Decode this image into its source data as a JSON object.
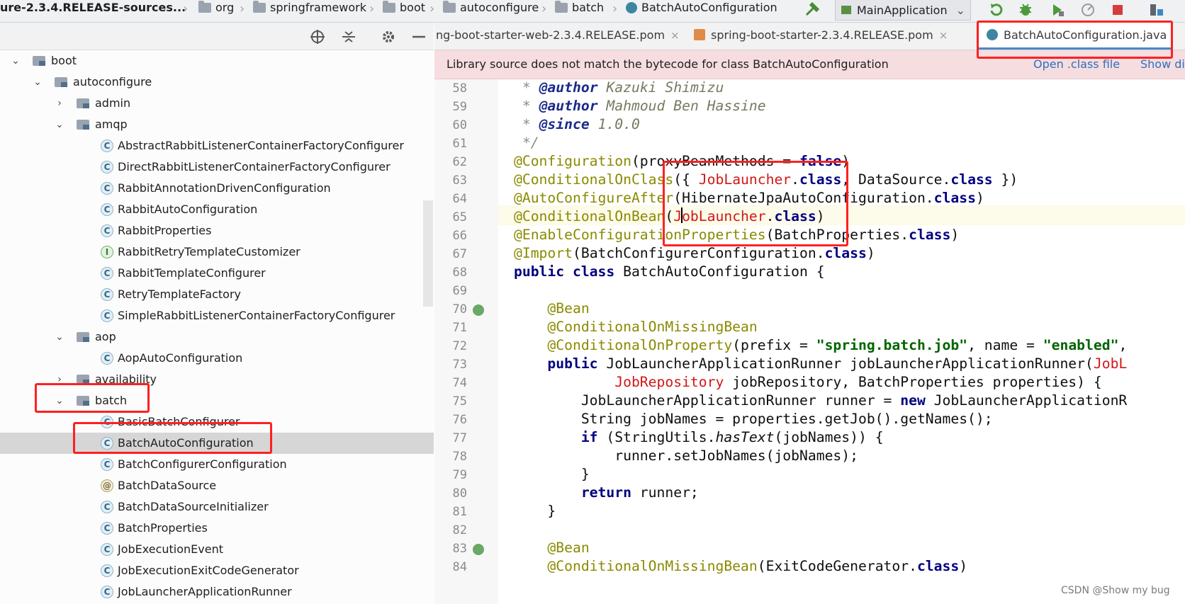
{
  "breadcrumb": {
    "project": "ure-2.3.4.RELEASE-sources...",
    "items": [
      "org",
      "springframework",
      "boot",
      "autoconfigure",
      "batch",
      "BatchAutoConfiguration"
    ]
  },
  "run_config": "MainApplication",
  "tabs": [
    {
      "label": "ng-boot-starter-web-2.3.4.RELEASE.pom",
      "active": false
    },
    {
      "label": "spring-boot-starter-2.3.4.RELEASE.pom",
      "active": false
    },
    {
      "label": "BatchAutoConfiguration.java",
      "active": true
    }
  ],
  "banner": {
    "message": "Library source does not match the bytecode for class BatchAutoConfiguration",
    "open_class": "Open .class file",
    "show": "Show di"
  },
  "tree": [
    {
      "label": "boot",
      "type": "folder",
      "arrow": "down"
    },
    {
      "label": "autoconfigure",
      "type": "folder",
      "arrow": "down"
    },
    {
      "label": "admin",
      "type": "folder",
      "arrow": "right"
    },
    {
      "label": "amqp",
      "type": "folder",
      "arrow": "down"
    },
    {
      "label": "AbstractRabbitListenerContainerFactoryConfigurer",
      "type": "class"
    },
    {
      "label": "DirectRabbitListenerContainerFactoryConfigurer",
      "type": "class"
    },
    {
      "label": "RabbitAnnotationDrivenConfiguration",
      "type": "class"
    },
    {
      "label": "RabbitAutoConfiguration",
      "type": "class"
    },
    {
      "label": "RabbitProperties",
      "type": "class"
    },
    {
      "label": "RabbitRetryTemplateCustomizer",
      "type": "interface"
    },
    {
      "label": "RabbitTemplateConfigurer",
      "type": "class"
    },
    {
      "label": "RetryTemplateFactory",
      "type": "class"
    },
    {
      "label": "SimpleRabbitListenerContainerFactoryConfigurer",
      "type": "class"
    },
    {
      "label": "aop",
      "type": "folder",
      "arrow": "down"
    },
    {
      "label": "AopAutoConfiguration",
      "type": "class"
    },
    {
      "label": "availability",
      "type": "folder",
      "arrow": "right"
    },
    {
      "label": "batch",
      "type": "folder",
      "arrow": "down"
    },
    {
      "label": "BasicBatchConfigurer",
      "type": "class"
    },
    {
      "label": "BatchAutoConfiguration",
      "type": "class",
      "selected": true
    },
    {
      "label": "BatchConfigurerConfiguration",
      "type": "class"
    },
    {
      "label": "BatchDataSource",
      "type": "annotation"
    },
    {
      "label": "BatchDataSourceInitializer",
      "type": "class"
    },
    {
      "label": "BatchProperties",
      "type": "class"
    },
    {
      "label": "JobExecutionEvent",
      "type": "class"
    },
    {
      "label": "JobExecutionExitCodeGenerator",
      "type": "class"
    },
    {
      "label": "JobLauncherApplicationRunner",
      "type": "class"
    }
  ],
  "code": {
    "line_numbers": [
      "58",
      "59",
      "60",
      "61",
      "62",
      "63",
      "64",
      "65",
      "66",
      "67",
      "68",
      "69",
      "70",
      "71",
      "72",
      "73",
      "74",
      "75",
      "76",
      "77",
      "78",
      "79",
      "80",
      "81",
      "82",
      "83",
      "84"
    ],
    "tokens": [
      [
        "<author-tag>",
        "Kazuki Shimizu"
      ],
      [
        "Mahmoud Ben Hassine"
      ],
      [
        "1.0.0"
      ]
    ],
    "author_tag": "@author",
    "since_tag": "@since",
    "lines": {
      "l62": {
        "ann": "@Configuration",
        "args": "(proxyBeanMethods = ",
        "kw": "false",
        "end": ")"
      },
      "l63": {
        "ann": "@ConditionalOnClass",
        "a": "({ ",
        "r": "JobLauncher",
        "b": ".",
        "kw": "class",
        "c": ", DataSource.",
        "kw2": "class",
        "d": " })"
      },
      "l64": {
        "ann": "@AutoConfigureAfter",
        "a": "(HibernateJpaAutoConfiguration.",
        "kw": "class",
        "b": ")"
      },
      "l65": {
        "ann": "@ConditionalOnBean",
        "a": "(",
        "r": "JobLauncher",
        "b": ".",
        "kw": "class",
        "c": ")"
      },
      "l66": {
        "ann": "@EnableConfigurationProperties",
        "a": "(BatchProperties.",
        "kw": "class",
        "b": ")"
      },
      "l67": {
        "ann": "@Import",
        "a": "(BatchConfigurerConfiguration.",
        "kw": "class",
        "b": ")"
      },
      "l68": {
        "kw": "public class",
        "a": " BatchAutoConfiguration {"
      },
      "l70": {
        "ann": "@Bean"
      },
      "l71": {
        "ann": "@ConditionalOnMissingBean"
      },
      "l72": {
        "ann": "@ConditionalOnProperty",
        "a": "(prefix = ",
        "s1": "\"spring.batch.job\"",
        "b": ", name = ",
        "s2": "\"enabled\"",
        "c": ","
      },
      "l73": {
        "kw": "public",
        "a": " JobLauncherApplicationRunner jobLauncherApplicationRunner(",
        "r": "JobL"
      },
      "l74": {
        "r": "JobRepository",
        "a": " jobRepository, BatchProperties properties) {"
      },
      "l75": {
        "a": "JobLauncherApplicationRunner runner = ",
        "kw": "new",
        "b": " JobLauncherApplicationR"
      },
      "l76": {
        "a": "String jobNames = properties.getJob().getNames();"
      },
      "l77": {
        "kw": "if",
        "a": " (StringUtils.",
        "m": "hasText",
        "b": "(jobNames)) {"
      },
      "l78": {
        "a": "runner.setJobNames(jobNames);"
      },
      "l79": {
        "a": "}"
      },
      "l80": {
        "kw": "return",
        "a": " runner;"
      },
      "l81": {
        "a": "}"
      },
      "l83": {
        "ann": "@Bean"
      },
      "l84": {
        "ann": "@ConditionalOnMissingBean",
        "a": "(ExitCodeGenerator.",
        "kw": "class",
        "b": ")"
      }
    }
  },
  "watermark": "CSDN @Show my bug",
  "colors": {
    "highlight_box": "#ff2020",
    "banner_bg": "#f6dde0",
    "link": "#2f6fbd"
  }
}
